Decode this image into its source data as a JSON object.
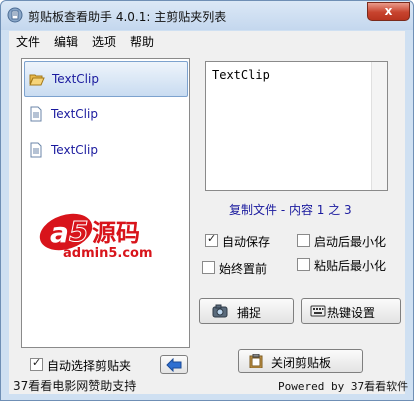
{
  "window": {
    "title": "剪贴板查看助手 4.0.1: 主剪贴夹列表",
    "close_glyph": "x"
  },
  "menu": {
    "items": [
      {
        "label": "文件"
      },
      {
        "label": "编辑"
      },
      {
        "label": "选项"
      },
      {
        "label": "帮助"
      }
    ]
  },
  "clip_list": {
    "items": [
      {
        "label": "TextClip",
        "icon": "folder-open-icon",
        "selected": true
      },
      {
        "label": "TextClip",
        "icon": "document-icon",
        "selected": false
      },
      {
        "label": "TextClip",
        "icon": "document-icon",
        "selected": false
      }
    ]
  },
  "watermark": {
    "letter": "a",
    "digit": "5",
    "chinese": "源码",
    "url": "admin5.com"
  },
  "content": {
    "text": "TextClip",
    "status": "复制文件 - 内容 1 之 3"
  },
  "options": {
    "auto_save": {
      "label": "自动保存",
      "checked": true
    },
    "always_on_top": {
      "label": "始终置前",
      "checked": false
    },
    "minimize_after_start": {
      "label": "启动后最小化",
      "checked": false
    },
    "minimize_after_paste": {
      "label": "粘贴后最小化",
      "checked": false
    },
    "auto_select_folder": {
      "label": "自动选择剪贴夹",
      "checked": true
    }
  },
  "buttons": {
    "capture": "捕捉",
    "hotkey_settings": "热键设置",
    "close_clipboard": "关闭剪贴板"
  },
  "footer": {
    "left": "37看看电影网赞助支持",
    "right": "Powered by 37看看软件"
  },
  "colors": {
    "accent_red": "#d8141b",
    "link_blue": "#1a1a9e",
    "title_bg": "#c4d7ee"
  }
}
